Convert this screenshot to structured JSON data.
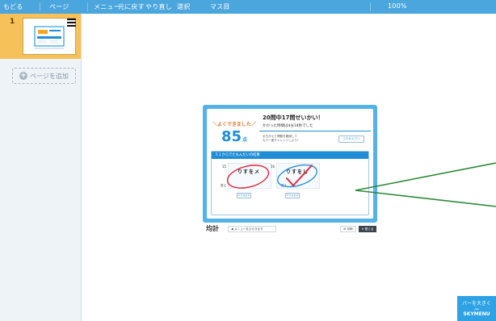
{
  "toolbar": {
    "back": "もどる",
    "page": "ページ",
    "menu": "メニュー",
    "undo": "元に戻す",
    "redo": "やり直し",
    "select": "選択",
    "grid": "マス目",
    "zoom": "100%"
  },
  "sidebar": {
    "page_number": "1",
    "add_page": "ページを追加"
  },
  "slide": {
    "badge": "よくできました",
    "score": "85",
    "score_unit": "点",
    "headline": "20問中17問せいかい！",
    "subline": "かかった時間は4分34秒でした",
    "comment_line1": "まちがえた問題を確認して",
    "comment_line2": "もう一度チャレンジしよう！",
    "review_button": "ふりかえりへ",
    "result_title": "５１からでたもんだいの結果",
    "q1": {
      "number": "15",
      "answer": "りすをメ",
      "label": "答え",
      "button": "やりなおす"
    },
    "q2": {
      "number": "16",
      "answer": "りすをし",
      "label": "答え",
      "button": "やりなおす"
    }
  },
  "slide_footer": {
    "logo": "均計",
    "back_button": "メニューをひらきます",
    "print_button": "印刷",
    "close_button": "✕ 閉じる"
  },
  "sky_button": {
    "line1": "バーを大きく",
    "chevron": "︽",
    "line2": "SKYMENU"
  },
  "colors": {
    "toolbar": "#4aa6dd",
    "page_card": "#f7c15a",
    "slide_frame": "#55b2e6",
    "accent_blue": "#1f8ed6",
    "mark_red": "#e02a3c",
    "mark_blue": "#2b8fd6",
    "arrow": "#2e8a3a"
  }
}
